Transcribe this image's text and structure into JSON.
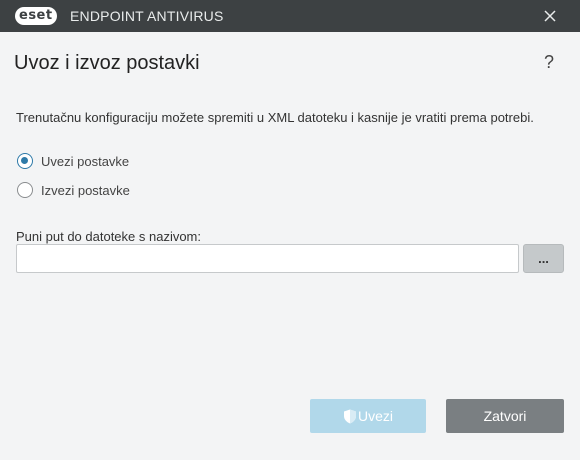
{
  "titlebar": {
    "logo_text": "eset",
    "product_name": "ENDPOINT ANTIVIRUS",
    "close_icon": "close-icon"
  },
  "header": {
    "title": "Uvoz i izvoz postavki",
    "help_label": "?"
  },
  "main": {
    "description": "Trenutačnu konfiguraciju možete spremiti u XML datoteku i kasnije je vratiti prema potrebi.",
    "options": [
      {
        "label": "Uvezi postavke",
        "checked": true
      },
      {
        "label": "Izvezi postavke",
        "checked": false
      }
    ],
    "path_label": "Puni put do datoteke s nazivom:",
    "path_value": "",
    "browse_label": "..."
  },
  "footer": {
    "import_label": "Uvezi",
    "import_icon": "shield-icon",
    "close_label": "Zatvori"
  },
  "colors": {
    "titlebar": "#3d4143",
    "accent": "#2e7aa8",
    "import_button_disabled": "#b1d8ea",
    "close_button": "#7a7f82"
  }
}
